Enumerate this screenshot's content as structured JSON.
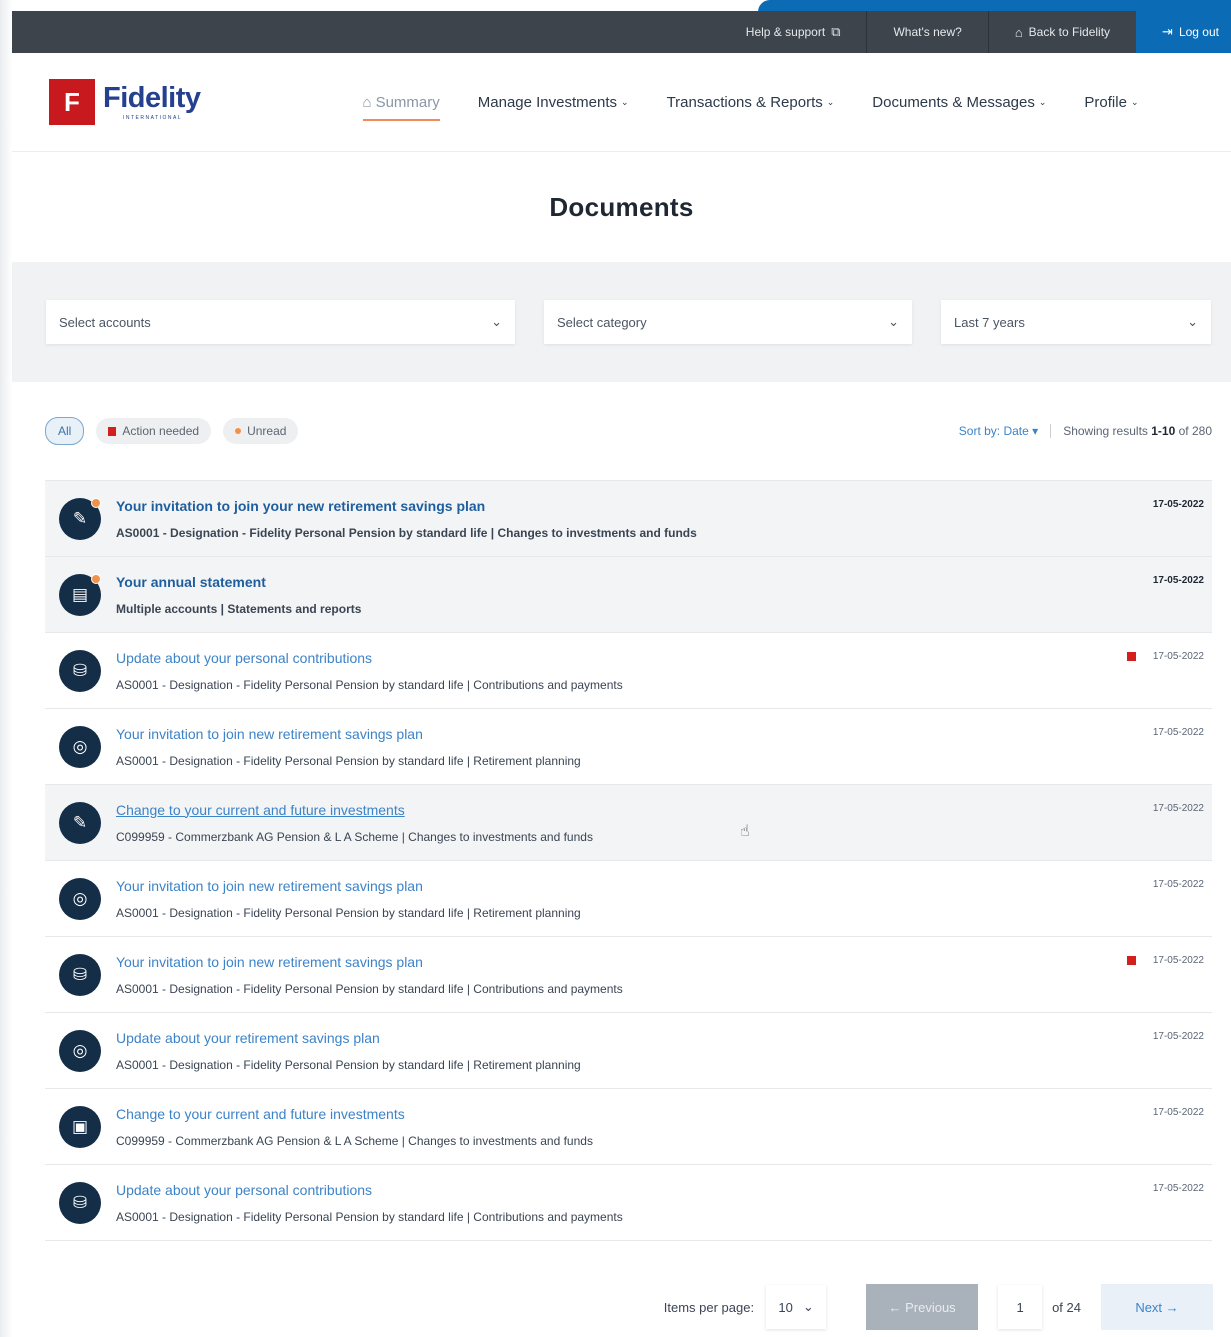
{
  "utility_bar": {
    "help": "Help & support",
    "whats_new": "What's new?",
    "back": "Back to Fidelity",
    "logout": "Log out"
  },
  "brand": {
    "name": "Fidelity",
    "tagline": "INTERNATIONAL"
  },
  "nav": {
    "items": [
      {
        "label": "Summary",
        "icon": "home-icon",
        "active": true
      },
      {
        "label": "Manage Investments"
      },
      {
        "label": "Transactions & Reports"
      },
      {
        "label": "Documents & Messages"
      },
      {
        "label": "Profile"
      }
    ]
  },
  "page": {
    "title": "Documents"
  },
  "filters": {
    "accounts": "Select accounts",
    "category": "Select category",
    "period": "Last 7 years"
  },
  "chips": {
    "all": "All",
    "action": "Action needed",
    "unread": "Unread"
  },
  "sort": {
    "label": "Sort by: Date",
    "results_prefix": "Showing results",
    "results_range": "1-10",
    "results_of": "of 280"
  },
  "documents": [
    {
      "title": "Your invitation to join your new retirement savings plan",
      "meta": "AS0001 - Designation - Fidelity Personal Pension by standard life | Changes to investments and funds",
      "date": "17-05-2022",
      "icon": "pen-icon",
      "unread": true,
      "flag": false
    },
    {
      "title": "Your annual statement",
      "meta": "Multiple accounts | Statements and reports",
      "date": "17-05-2022",
      "icon": "document-icon",
      "unread": true,
      "flag": false
    },
    {
      "title": "Update about your personal contributions",
      "meta": "AS0001 - Designation - Fidelity Personal Pension by standard life | Contributions and payments",
      "date": "17-05-2022",
      "icon": "coins-icon",
      "unread": false,
      "flag": true
    },
    {
      "title": "Your invitation to join new retirement savings plan",
      "meta": "AS0001 - Designation - Fidelity Personal Pension by standard life | Retirement planning",
      "date": "17-05-2022",
      "icon": "piggy-bank-icon",
      "unread": false,
      "flag": false
    },
    {
      "title": "Change to your current and future investments",
      "meta": "C099959 - Commerzbank AG Pension & L A Scheme | Changes to investments and funds",
      "date": "17-05-2022",
      "icon": "pen-icon",
      "unread": false,
      "flag": false,
      "hover": true
    },
    {
      "title": "Your invitation to join new retirement savings plan",
      "meta": "AS0001 - Designation - Fidelity Personal Pension by standard life | Retirement planning",
      "date": "17-05-2022",
      "icon": "piggy-bank-icon",
      "unread": false,
      "flag": false
    },
    {
      "title": "Your invitation to join new retirement savings plan",
      "meta": "AS0001 - Designation - Fidelity Personal Pension by standard life | Contributions and payments",
      "date": "17-05-2022",
      "icon": "coins-icon",
      "unread": false,
      "flag": true
    },
    {
      "title": "Update about your retirement savings plan",
      "meta": "AS0001 - Designation - Fidelity Personal Pension by standard life | Retirement planning",
      "date": "17-05-2022",
      "icon": "piggy-bank-icon",
      "unread": false,
      "flag": false
    },
    {
      "title": "Change to your current and future investments",
      "meta": "C099959 - Commerzbank AG Pension & L A Scheme | Changes to investments and funds",
      "date": "17-05-2022",
      "icon": "monitor-icon",
      "unread": false,
      "flag": false
    },
    {
      "title": "Update about your personal contributions",
      "meta": "AS0001 - Designation - Fidelity Personal Pension by standard life | Contributions and payments",
      "date": "17-05-2022",
      "icon": "coins-icon",
      "unread": false,
      "flag": false
    }
  ],
  "pagination": {
    "items_label": "Items per page:",
    "items_value": "10",
    "prev": "Previous",
    "page": "1",
    "of_total": "of 24",
    "next": "Next"
  }
}
